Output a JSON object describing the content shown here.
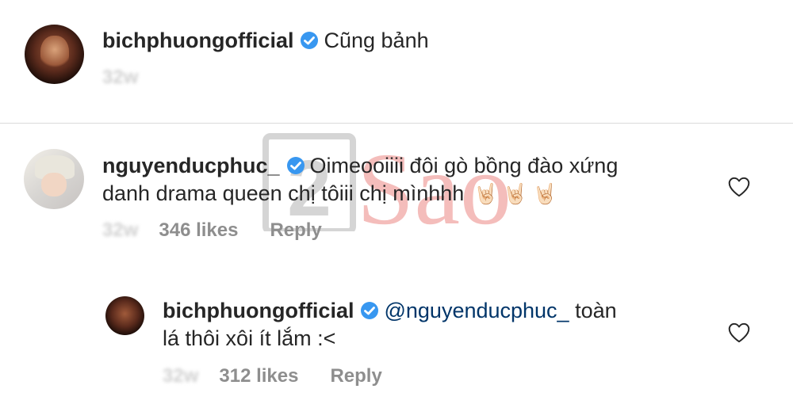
{
  "comments": [
    {
      "username": "bichphuongofficial",
      "text": "Cũng bảnh",
      "time": "32w"
    },
    {
      "username": "nguyenducphuc_",
      "text_line1": "Oimeooiiii đôi gò bồng đào xứng",
      "text_line2": "danh drama queen chị tôiii chị mìnhhh",
      "emoji": "🤘🏻🤘🏻🤘🏻",
      "time": "32w",
      "likes": "346 likes",
      "reply_label": "Reply"
    },
    {
      "username": "bichphuongofficial",
      "mention": "@nguyenducphuc_",
      "text_line1_rest": "toàn",
      "text_line2": "lá thôi xôi ít lắm :<",
      "time": "32w",
      "likes": "312 likes",
      "reply_label": "Reply"
    }
  ],
  "watermark": {
    "number": "2",
    "text": "Sao"
  },
  "colors": {
    "verified": "#3897f0",
    "text": "#262626",
    "meta": "#8e8e8e",
    "mention": "#003569",
    "watermark_red": "#e0443f",
    "watermark_gray": "#8a8a8a"
  },
  "icons": {
    "verified": "verified-badge-icon",
    "like": "heart-outline-icon"
  }
}
